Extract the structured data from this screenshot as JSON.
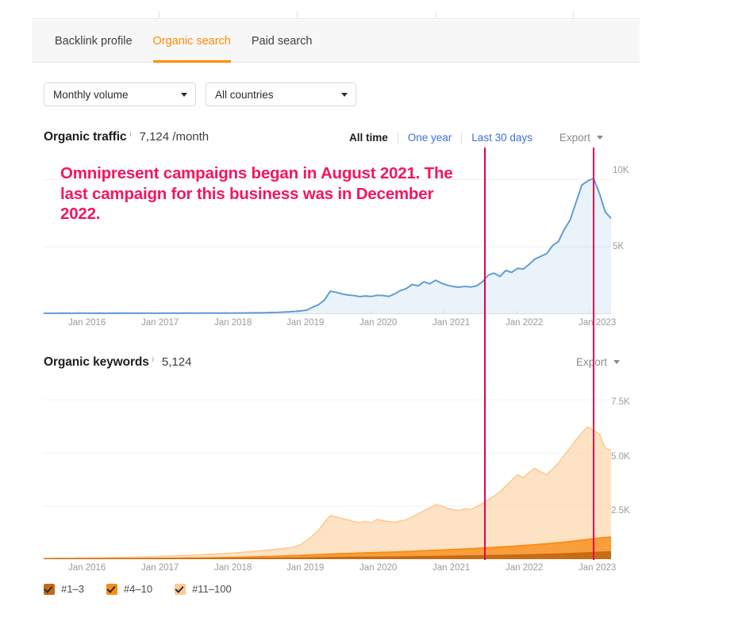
{
  "tabs": [
    {
      "label": "Backlink profile",
      "active": false
    },
    {
      "label": "Organic search",
      "active": true
    },
    {
      "label": "Paid search",
      "active": false
    }
  ],
  "filters": [
    {
      "name": "metric-select",
      "value": "Monthly volume"
    },
    {
      "name": "country-select",
      "value": "All countries"
    }
  ],
  "traffic": {
    "title": "Organic traffic",
    "info_icon": "i",
    "value": "7,124 /month",
    "ranges": [
      {
        "label": "All time",
        "active": true
      },
      {
        "label": "One year",
        "active": false
      },
      {
        "label": "Last 30 days",
        "active": false
      }
    ],
    "export_label": "Export"
  },
  "keywords": {
    "title": "Organic keywords",
    "info_icon": "i",
    "value": "5,124",
    "export_label": "Export"
  },
  "annotation": {
    "text": "Omnipresent campaigns began in August 2021. The last campaign for this business was in December 2022.",
    "color": "#f3165f"
  },
  "legend": [
    {
      "label": "#1–3",
      "color": "#c36a16"
    },
    {
      "label": "#4–10",
      "color": "#f78d18"
    },
    {
      "label": "#11–100",
      "color": "#fbcb93"
    }
  ],
  "colors": {
    "accent": "#ff8b00",
    "link": "#3f6fd8",
    "marker": "#e8004f",
    "traffic_line": "#5b9bd5",
    "traffic_fill": "#eaf2fb"
  },
  "chart_data": [
    {
      "type": "line",
      "title": "Organic traffic",
      "xlabel": "",
      "ylabel": "",
      "ylim": [
        0,
        11800
      ],
      "yticks": [
        5000,
        10000
      ],
      "ytick_labels": [
        "5K",
        "10K"
      ],
      "grid": true,
      "legend_position": "none",
      "x": [
        "Jan 2016",
        "Jan 2017",
        "Jan 2018",
        "Jan 2019",
        "Jan 2020",
        "Jan 2021",
        "Jan 2022",
        "Jan 2023"
      ],
      "series": [
        {
          "name": "Organic traffic",
          "color": "#5b9bd5",
          "values": [
            60,
            62,
            58,
            70,
            66,
            60,
            72,
            68,
            64,
            70,
            66,
            62,
            70,
            66,
            74,
            70,
            66,
            72,
            68,
            64,
            70,
            74,
            70,
            66,
            78,
            74,
            80,
            76,
            82,
            78,
            74,
            80,
            76,
            86,
            82,
            90,
            100,
            96,
            110,
            120,
            130,
            150,
            170,
            200,
            240,
            300,
            520,
            700,
            1050,
            1700,
            1620,
            1500,
            1420,
            1380,
            1300,
            1350,
            1310,
            1400,
            1380,
            1320,
            1500,
            1750,
            1900,
            2200,
            2100,
            2400,
            2250,
            2520,
            2300,
            2150,
            2050,
            2000,
            2060,
            2020,
            2100,
            2400,
            2900,
            3050,
            2800,
            3250,
            3100,
            3400,
            3350,
            3700,
            4100,
            4300,
            4500,
            5100,
            5400,
            6300,
            7000,
            8300,
            9600,
            9900,
            10100,
            9000,
            7600,
            7124
          ]
        }
      ],
      "annotations": [
        {
          "type": "vline",
          "x": "Aug 2021",
          "color": "#e8004f"
        },
        {
          "type": "vline",
          "x": "Dec 2022",
          "color": "#e8004f"
        }
      ]
    },
    {
      "type": "area",
      "title": "Organic keywords",
      "xlabel": "",
      "ylabel": "",
      "ylim": [
        0,
        8400
      ],
      "yticks": [
        2500,
        5000,
        7500
      ],
      "ytick_labels": [
        "2.5K",
        "5.0K",
        "7.5K"
      ],
      "grid": true,
      "stacked": true,
      "legend_position": "bottom",
      "x": [
        "Jan 2016",
        "Jan 2017",
        "Jan 2018",
        "Jan 2019",
        "Jan 2020",
        "Jan 2021",
        "Jan 2022",
        "Jan 2023"
      ],
      "series": [
        {
          "name": "#1–3",
          "color": "#c36a16",
          "values": [
            4,
            4,
            5,
            5,
            5,
            6,
            6,
            6,
            7,
            7,
            7,
            8,
            8,
            8,
            9,
            9,
            10,
            10,
            11,
            11,
            12,
            12,
            13,
            13,
            14,
            15,
            16,
            17,
            18,
            19,
            20,
            21,
            22,
            24,
            26,
            28,
            30,
            32,
            34,
            36,
            38,
            40,
            42,
            46,
            50,
            54,
            58,
            62,
            66,
            70,
            74,
            78,
            80,
            82,
            84,
            86,
            88,
            90,
            92,
            94,
            96,
            100,
            104,
            108,
            112,
            116,
            120,
            124,
            128,
            132,
            136,
            140,
            144,
            148,
            152,
            156,
            160,
            166,
            172,
            178,
            184,
            190,
            196,
            202,
            208,
            216,
            224,
            232,
            240,
            250,
            260,
            272,
            284,
            296,
            308,
            320,
            330,
            340
          ]
        },
        {
          "name": "#4–10",
          "color": "#f78d18",
          "values": [
            8,
            8,
            9,
            9,
            10,
            10,
            11,
            11,
            12,
            12,
            13,
            14,
            15,
            16,
            17,
            18,
            19,
            20,
            22,
            24,
            26,
            28,
            30,
            32,
            34,
            36,
            38,
            40,
            42,
            46,
            50,
            54,
            58,
            62,
            66,
            70,
            76,
            82,
            88,
            94,
            100,
            106,
            112,
            120,
            128,
            136,
            144,
            152,
            160,
            168,
            176,
            184,
            190,
            196,
            202,
            208,
            214,
            220,
            226,
            232,
            238,
            246,
            254,
            262,
            270,
            278,
            286,
            294,
            302,
            310,
            318,
            326,
            334,
            344,
            354,
            364,
            374,
            386,
            398,
            410,
            422,
            434,
            446,
            458,
            470,
            486,
            502,
            518,
            534,
            552,
            570,
            590,
            610,
            630,
            650,
            670,
            690,
            700
          ]
        },
        {
          "name": "#11–100",
          "color": "#fbcb93",
          "values": [
            30,
            32,
            34,
            36,
            38,
            40,
            42,
            44,
            46,
            48,
            50,
            54,
            58,
            62,
            66,
            70,
            74,
            78,
            84,
            90,
            96,
            102,
            110,
            118,
            126,
            134,
            142,
            150,
            160,
            170,
            180,
            190,
            200,
            215,
            230,
            245,
            260,
            280,
            300,
            320,
            340,
            360,
            380,
            420,
            520,
            700,
            900,
            1150,
            1500,
            1820,
            1740,
            1650,
            1580,
            1500,
            1440,
            1480,
            1420,
            1560,
            1500,
            1440,
            1400,
            1450,
            1500,
            1620,
            1740,
            1880,
            2010,
            2140,
            2080,
            1960,
            1880,
            1820,
            1900,
            1840,
            1960,
            2100,
            2260,
            2420,
            2600,
            2850,
            3100,
            3350,
            3200,
            3420,
            3600,
            3400,
            3250,
            3500,
            3750,
            4100,
            4400,
            4750,
            5050,
            5300,
            5100,
            4900,
            4200,
            4084
          ]
        }
      ],
      "annotations": [
        {
          "type": "vline",
          "x": "Aug 2021",
          "color": "#e8004f"
        },
        {
          "type": "vline",
          "x": "Dec 2022",
          "color": "#e8004f"
        }
      ]
    }
  ]
}
